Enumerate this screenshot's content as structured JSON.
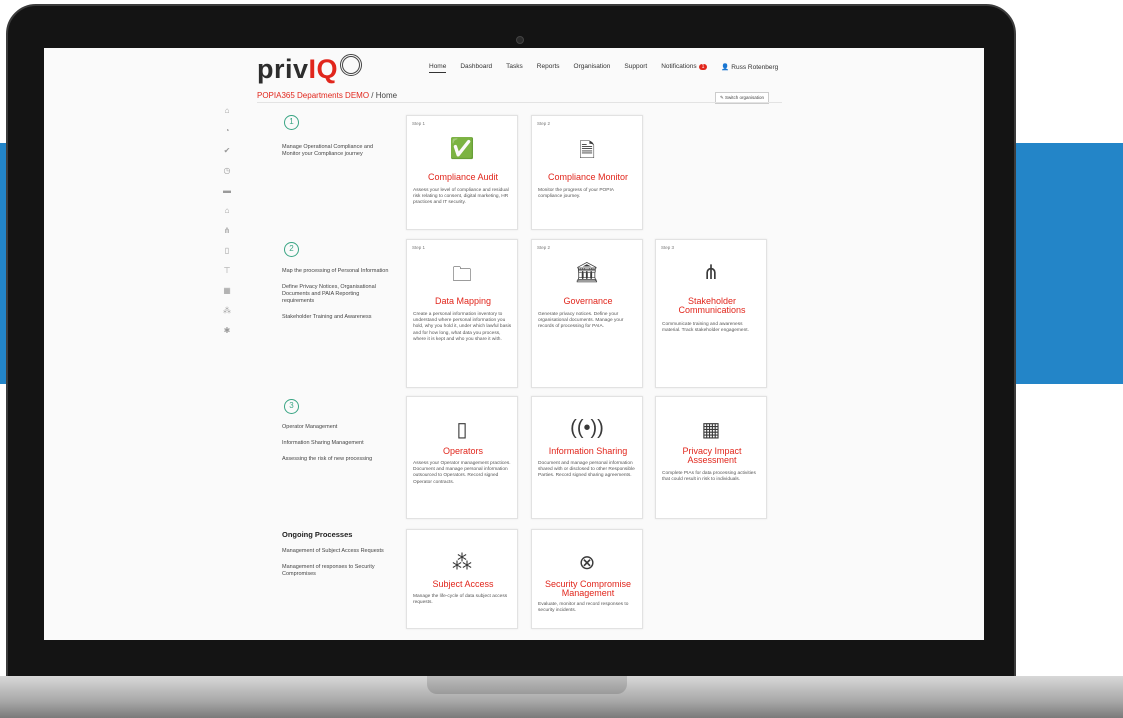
{
  "app": {
    "logo_text": "priv",
    "logo_accent": "IQ",
    "brand_color": "#e1261c",
    "accent_blue": "#2385c8",
    "step_color": "#3aa584"
  },
  "nav": {
    "home": "Home",
    "dashboard": "Dashboard",
    "tasks": "Tasks",
    "reports": "Reports",
    "organisation": "Organisation",
    "support": "Support",
    "notifications": "Notifications",
    "notifications_count": "1",
    "user": "Russ Rotenberg"
  },
  "breadcrumb": {
    "org": "POPIA365 Departments DEMO",
    "sep": "/",
    "page": "Home"
  },
  "switch_org_label": "Switch organisation",
  "sidebar_icons": [
    "home-icon",
    "dashboard-icon",
    "check-icon",
    "monitor-icon",
    "folder-icon",
    "bank-icon",
    "hierarchy-icon",
    "operators-icon",
    "sharing-icon",
    "building-icon",
    "users-icon",
    "security-icon"
  ],
  "sections": {
    "s1": {
      "number": "1",
      "items": [
        "Manage Operational Compliance and Monitor your Compliance journey"
      ]
    },
    "s2": {
      "number": "2",
      "items": [
        "Map the processing of Personal Information",
        "Define Privacy Notices, Organisational Documents and PAIA Reporting requirements",
        "Stakeholder Training and Awareness"
      ]
    },
    "s3": {
      "number": "3",
      "items": [
        "Operator Management",
        "Information Sharing Management",
        "Assessing the risk of new processing"
      ]
    },
    "ongoing": {
      "title": "Ongoing Processes",
      "items": [
        "Management of Subject Access Requests",
        "Management of responses to Security Compromises"
      ]
    }
  },
  "cards": {
    "compliance_audit": {
      "step": "Step 1",
      "icon": "check-circle-icon",
      "title": "Compliance Audit",
      "desc": "Assess your level of compliance and residual risk relating to consent, digital marketing, HR practices and IT security."
    },
    "compliance_monitor": {
      "step": "Step 2",
      "icon": "monitor-shield-icon",
      "title": "Compliance Monitor",
      "desc": "Monitor the progress of your POPIA compliance journey."
    },
    "data_mapping": {
      "step": "Step 1",
      "icon": "folder-network-icon",
      "title": "Data Mapping",
      "desc": "Create a personal information inventory to understand where personal information you hold, why you hold it, under which lawful basis and for how long, what data you process, where it is kept and who you share it with."
    },
    "governance": {
      "step": "Step 2",
      "icon": "bank-icon",
      "title": "Governance",
      "desc": "Generate privacy notices. Define your organisational documents. Manage your records of processing for PAIA."
    },
    "stakeholder": {
      "step": "Step 3",
      "icon": "hierarchy-icon",
      "title": "Stakeholder Communications",
      "desc": "Communicate training and awareness material. Track stakeholder engagement."
    },
    "operators": {
      "step": "",
      "icon": "tablet-hand-icon",
      "title": "Operators",
      "desc": "Assess your Operator management practices. Document and manage personal information outsourced to Operators. Record signed Operator contracts."
    },
    "info_sharing": {
      "step": "",
      "icon": "broadcast-icon",
      "title": "Information Sharing",
      "desc": "Document and manage personal information shared with or disclosed to other Responsible Parties. Record signed sharing agreements."
    },
    "pia": {
      "step": "",
      "icon": "building-icon",
      "title": "Privacy Impact Assessment",
      "desc": "Complete PIAs for data processing activities that could result in risk to individuals."
    },
    "subject_access": {
      "step": "",
      "icon": "users-check-icon",
      "title": "Subject Access",
      "desc": "Manage the life-cycle of data subject access requests."
    },
    "security": {
      "step": "",
      "icon": "security-compromise-icon",
      "title": "Security Compromise Management",
      "desc": "Evaluate, monitor and record responses to security incidents."
    }
  }
}
